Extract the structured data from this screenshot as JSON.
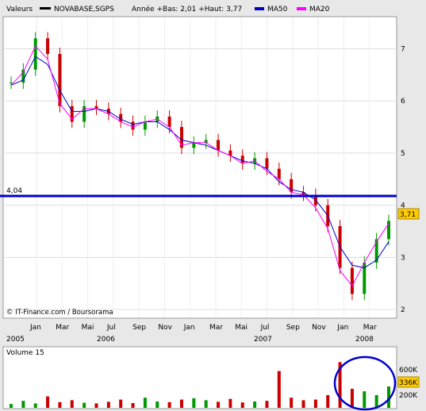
{
  "header": {
    "valeurs_label": "Valeurs",
    "ticker": "NOVABASE,SGPS",
    "range_text": "Année +Bas: 2,01 +Haut: 3,77",
    "ma50_label": "MA50",
    "ma20_label": "MA20"
  },
  "colors": {
    "price_line": "#000000",
    "ma50": "#0000cc",
    "ma20": "#ff00ff",
    "up_candle": "#009900",
    "down_candle": "#cc0000",
    "reference_line": "#0000cc",
    "last_price_bg": "#ffcc00",
    "highlight_circle": "#0000cc"
  },
  "credit": "© IT-Finance.com / Boursorama",
  "chart_data": [
    {
      "type": "candlestick",
      "ylim": [
        1.85,
        7.6
      ],
      "y_ticks": [
        "2",
        "3",
        "4",
        "5",
        "6",
        "7"
      ],
      "x_month_labels": [
        "Jan",
        "Mar",
        "Mai",
        "Jul",
        "Sep",
        "Nov",
        "Jan",
        "Mar",
        "Mai",
        "Jul",
        "Sep",
        "Nov",
        "Jan",
        "Mar"
      ],
      "x_year_labels": [
        "2005",
        "2006",
        "2007",
        "2008"
      ],
      "reference_line": {
        "value": 4.04,
        "label": "4,04"
      },
      "last_price": {
        "value": 3.71,
        "label": "3,71"
      },
      "price_series": {
        "name": "NOVABASE,SGPS",
        "x": [
          "2005-01",
          "2005-02",
          "2005-03",
          "2005-04",
          "2005-05",
          "2005-06",
          "2005-07",
          "2005-08",
          "2005-09",
          "2005-10",
          "2005-11",
          "2005-12",
          "2006-01",
          "2006-02",
          "2006-03",
          "2006-04",
          "2006-05",
          "2006-06",
          "2006-07",
          "2006-08",
          "2006-09",
          "2006-10",
          "2006-11",
          "2006-12",
          "2007-01",
          "2007-02",
          "2007-03",
          "2007-04",
          "2007-05",
          "2007-06",
          "2007-07",
          "2007-08",
          "2007-09",
          "2007-10",
          "2007-11",
          "2007-12",
          "2008-01",
          "2008-02",
          "2008-03"
        ],
        "y": [
          6.35,
          6.6,
          7.2,
          6.9,
          5.9,
          5.6,
          5.9,
          5.85,
          5.75,
          5.6,
          5.45,
          5.6,
          5.7,
          5.5,
          5.1,
          5.2,
          5.25,
          5.05,
          4.95,
          4.8,
          4.9,
          4.7,
          4.5,
          4.25,
          4.2,
          4.0,
          3.6,
          2.8,
          2.3,
          2.9,
          3.35,
          3.7
        ]
      },
      "ma50": {
        "name": "MA50",
        "y": [
          6.3,
          6.4,
          6.85,
          6.7,
          6.2,
          5.8,
          5.8,
          5.85,
          5.8,
          5.65,
          5.55,
          5.6,
          5.6,
          5.45,
          5.25,
          5.2,
          5.15,
          5.05,
          4.95,
          4.85,
          4.8,
          4.7,
          4.45,
          4.3,
          4.25,
          4.1,
          3.8,
          3.2,
          2.85,
          2.8,
          2.95,
          3.3
        ]
      },
      "ma20": {
        "name": "MA20",
        "y": [
          6.3,
          6.55,
          7.05,
          6.8,
          5.95,
          5.65,
          5.85,
          5.85,
          5.75,
          5.6,
          5.5,
          5.6,
          5.65,
          5.5,
          5.15,
          5.2,
          5.2,
          5.05,
          4.95,
          4.8,
          4.85,
          4.65,
          4.5,
          4.25,
          4.2,
          3.95,
          3.55,
          2.75,
          2.45,
          2.9,
          3.3,
          3.65
        ]
      }
    },
    {
      "type": "bar",
      "title": "Volume 15",
      "y_ticks": [
        "200K",
        "600K"
      ],
      "last_volume_label": "336K",
      "values_k": [
        60,
        110,
        70,
        180,
        90,
        120,
        80,
        70,
        95,
        130,
        75,
        160,
        100,
        90,
        130,
        150,
        120,
        95,
        140,
        85,
        100,
        110,
        580,
        160,
        120,
        130,
        200,
        720,
        300,
        260,
        200,
        336
      ]
    }
  ]
}
